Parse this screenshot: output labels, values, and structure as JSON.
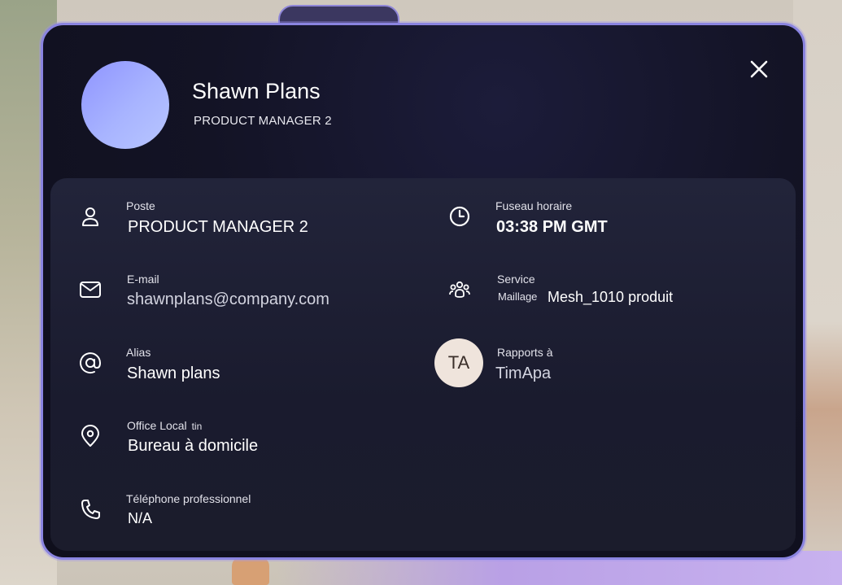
{
  "profile": {
    "name": "Shawn Plans",
    "title": "PRODUCT MANAGER 2"
  },
  "fields": {
    "poste": {
      "label": "Poste",
      "value": "PRODUCT MANAGER 2",
      "icon": "person-icon"
    },
    "email": {
      "label": "E-mail",
      "value": "shawnplans@company.com",
      "icon": "mail-icon"
    },
    "alias": {
      "label": "Alias",
      "value": "Shawn plans",
      "icon": "at-icon"
    },
    "office": {
      "label": "Office Local",
      "label_suffix": "tin",
      "value": "Bureau à domicile",
      "icon": "location-pin-icon"
    },
    "phone": {
      "label": "Téléphone professionnel",
      "value": "N/A",
      "icon": "phone-icon"
    },
    "timezone": {
      "label": "Fuseau horaire",
      "value": "03:38 PM GMT",
      "icon": "clock-icon"
    },
    "service": {
      "label": "Service",
      "sub_label": "Maillage",
      "value": "Mesh_1010 produit",
      "icon": "people-group-icon"
    },
    "reports_to": {
      "label": "Rapports à",
      "value": "TimApa",
      "initials": "TA"
    }
  },
  "colors": {
    "accent_border": "#8a84e0",
    "avatar_gradient_start": "#8f94ff",
    "avatar_gradient_end": "#b8c6ff"
  }
}
